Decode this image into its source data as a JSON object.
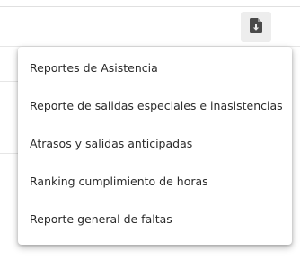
{
  "toolbar": {
    "download_icon": "file-download-icon",
    "icon_color": "#4a4a4a",
    "button_bg": "#ededed"
  },
  "menu": {
    "items": [
      {
        "label": "Reportes de Asistencia"
      },
      {
        "label": "Reporte de salidas especiales e inasistencias"
      },
      {
        "label": "Atrasos y salidas anticipadas"
      },
      {
        "label": "Ranking cumplimiento de horas"
      },
      {
        "label": "Reporte general de faltas"
      }
    ]
  }
}
